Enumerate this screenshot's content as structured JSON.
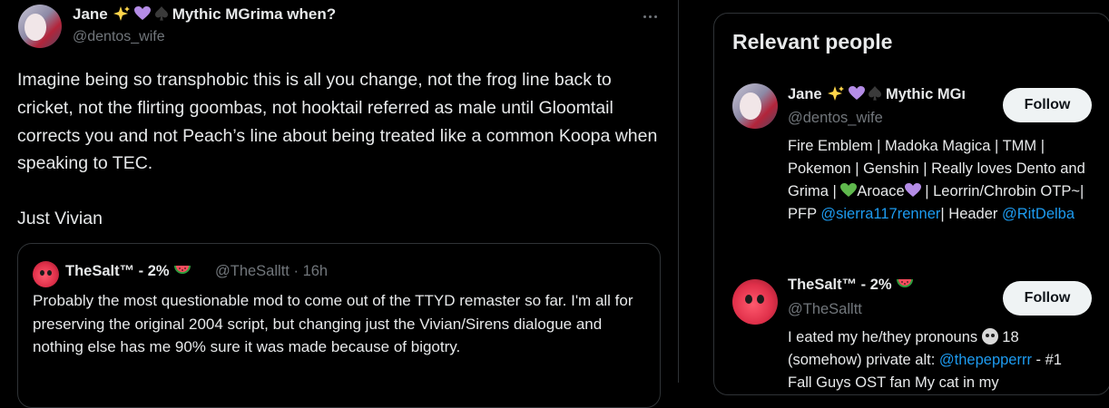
{
  "tweet": {
    "author_name": "Jane",
    "author_name_suffix": "Mythic MGrima when?",
    "author_handle": "@dentos_wife",
    "paragraph1": "Imagine being so transphobic this is all you change, not the frog line back to cricket, not the flirting goombas, not hooktail referred as male until Gloomtail corrects you and not Peach’s line about being treated like a common Koopa when speaking to TEC.",
    "paragraph2": "Just Vivian",
    "quote": {
      "author_name": "TheSalt™ - 2%",
      "author_handle": "@TheSalltt",
      "separator": "·",
      "time": "16h",
      "text": "Probably the most questionable mod to come out of the TTYD remaster so far. I'm all for preserving the original 2004 script, but changing just the Vivian/Sirens dialogue and nothing else has me 90% sure it was made because of bigotry."
    }
  },
  "sidebar": {
    "title": "Relevant people",
    "people": [
      {
        "name": "Jane",
        "name_suffix": "Mythic MGı",
        "handle": "@dentos_wife",
        "follow_label": "Follow",
        "bio_a": "Fire Emblem | Madoka Magica | TMM | Pokemon | Genshin | Really loves Dento and Grima | ",
        "bio_b": "Aroace",
        "bio_c": " | Leorrin/Chrobin OTP~| PFP ",
        "bio_link1": "@sierra117renner",
        "bio_d": "| Header ",
        "bio_link2": "@RitDelba"
      },
      {
        "name": "TheSalt™ - 2%",
        "handle": "@TheSalltt",
        "follow_label": "Follow",
        "bio_a": "I eated my he/they pronouns ",
        "bio_b": " 18 (somehow) private alt: ",
        "bio_link1": "@thepepperrr",
        "bio_c": " - #1 Fall Guys OST fan My cat in my"
      }
    ]
  },
  "colors": {
    "background": "#000000",
    "text": "#e7e9ea",
    "muted": "#71767b",
    "link": "#1d9bf0",
    "border": "#2f3336",
    "button_bg": "#eff3f4"
  }
}
